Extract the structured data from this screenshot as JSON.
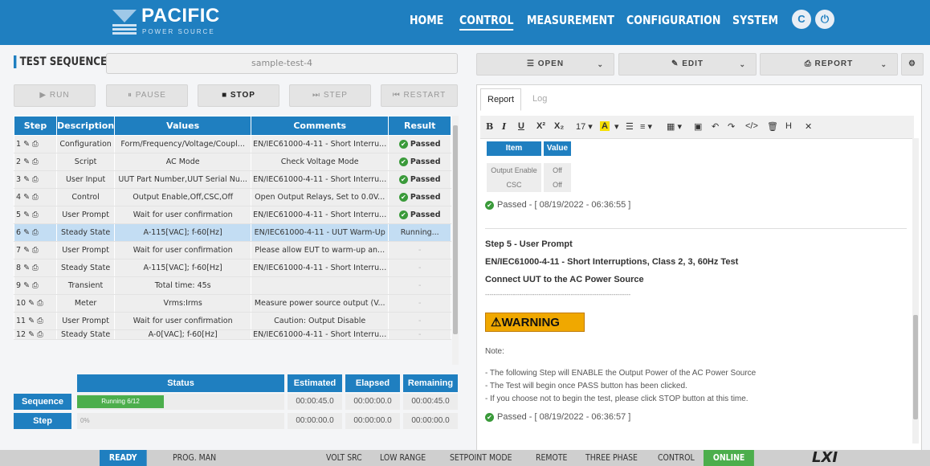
{
  "header": {
    "brand": "PACIFIC",
    "brand_sub": "POWER SOURCE",
    "nav": [
      "HOME",
      "CONTROL",
      "MEASUREMENT",
      "CONFIGURATION",
      "SYSTEM"
    ],
    "active_nav": "CONTROL",
    "icons": [
      "refresh-icon",
      "power-icon"
    ]
  },
  "sequence": {
    "title": "TEST SEQUENCE",
    "name": "sample-test-4"
  },
  "toolbar": {
    "run": "▶ RUN",
    "pause": "⏸ PAUSE",
    "stop": "■ STOP",
    "step": "⏭ STEP",
    "restart": "⏮ RESTART"
  },
  "actions": {
    "open": "☰ OPEN",
    "edit": "✎ EDIT",
    "report": "⎙ REPORT"
  },
  "steps_table": {
    "columns": [
      "Step",
      "Description",
      "Values",
      "Comments",
      "Result"
    ],
    "rows": [
      {
        "step": "1 ✎ ⎙",
        "description": "Configuration",
        "values": "Form/Frequency/Voltage/Coupl...",
        "comments": "EN/IEC61000-4-11 - Short Interru...",
        "result": "Passed"
      },
      {
        "step": "2 ✎ ⎙",
        "description": "Script",
        "values": "AC Mode",
        "comments": "Check Voltage Mode",
        "result": "Passed"
      },
      {
        "step": "3 ✎ ⎙",
        "description": "User Input",
        "values": "UUT Part Number,UUT Serial Nu...",
        "comments": "EN/IEC61000-4-11 - Short Interru...",
        "result": "Passed"
      },
      {
        "step": "4 ✎ ⎙",
        "description": "Control",
        "values": "Output Enable,Off,CSC,Off",
        "comments": "Open Output Relays, Set to 0.0V...",
        "result": "Passed"
      },
      {
        "step": "5 ✎ ⎙",
        "description": "User Prompt",
        "values": "Wait for user confirmation",
        "comments": "EN/IEC61000-4-11 - Short Interru...",
        "result": "Passed"
      },
      {
        "step": "6 ✎ ⎙",
        "description": "Steady State",
        "values": "A-115[VAC]; f-60[Hz]",
        "comments": "EN/IEC61000-4-11 - UUT Warm-Up",
        "result": "Running..."
      },
      {
        "step": "7 ✎ ⎙",
        "description": "User Prompt",
        "values": "Wait for user confirmation",
        "comments": "Please allow EUT to warm-up an...",
        "result": "-"
      },
      {
        "step": "8 ✎ ⎙",
        "description": "Steady State",
        "values": "A-115[VAC]; f-60[Hz]",
        "comments": "EN/IEC61000-4-11 - Short Interru...",
        "result": "-"
      },
      {
        "step": "9 ✎ ⎙",
        "description": "Transient",
        "values": "Total time: 45s",
        "comments": "",
        "result": "-"
      },
      {
        "step": "10 ✎ ⎙",
        "description": "Meter",
        "values": "Vrms:Irms",
        "comments": "Measure power source output (V...",
        "result": "-"
      },
      {
        "step": "11 ✎ ⎙",
        "description": "User Prompt",
        "values": "Wait for user confirmation",
        "comments": "Caution: Output Disable",
        "result": "-"
      },
      {
        "step": "12 ✎ ⎙",
        "description": "Steady State",
        "values": "A-0[VAC]; f-60[Hz]",
        "comments": "EN/IEC61000-4-11 - Short Interru...",
        "result": "-"
      }
    ]
  },
  "status": {
    "headers": [
      "Status",
      "Estimated",
      "Elapsed",
      "Remaining"
    ],
    "sequence_label": "Sequence",
    "step_label": "Step",
    "sequence_progress": "Running 6/12",
    "sequence_progress_fraction": 0.5,
    "step_progress": "0%",
    "sequence_times": [
      "00:00:45.0",
      "00:00:00.0",
      "00:00:45.0"
    ],
    "step_times": [
      "00:00:00.0",
      "00:00:00.0",
      "00:00:00.0"
    ]
  },
  "report": {
    "tabs": [
      "Report",
      "Log"
    ],
    "editor_tools": [
      "B",
      "I",
      "U",
      "X²",
      "X₂",
      "17 ▾",
      "A",
      "▾",
      "☰",
      "≡ ▾",
      "▦ ▾",
      "▣",
      "↶",
      "↷",
      "</>",
      "🗑",
      "H",
      "✕"
    ],
    "mini_table": {
      "headers": [
        "Item",
        "Value"
      ],
      "rows": [
        [
          "Output Enable",
          "Off"
        ],
        [
          "CSC",
          "Off"
        ]
      ]
    },
    "passed_1": "Passed - [ 08/19/2022 - 06:36:55 ]",
    "step5_title": "Step 5 - User Prompt",
    "step5_test": "EN/IEC61000-4-11 - Short Interruptions, Class 2, 3, 60Hz Test",
    "step5_action": "Connect UUT to the AC Power Source",
    "divider": "--------------------------------------------------------------------",
    "warning": "⚠WARNING",
    "note_label": "Note:",
    "notes": [
      "- The following Step will ENABLE the Output Power of the AC Power Source",
      "- The Test will begin once PASS button has been clicked.",
      "- If you choose not to begin the test, please click STOP button at this time."
    ],
    "passed_2": "Passed - [ 08/19/2022 - 06:36:57 ]"
  },
  "statusbar": {
    "items": [
      "READY",
      "PROG. MAN",
      "VOLT SRC",
      "LOW RANGE",
      "SETPOINT MODE",
      "REMOTE",
      "THREE PHASE",
      "CONTROL",
      "ONLINE"
    ],
    "logo": "LXI"
  },
  "colors": {
    "primary": "#1f7fc0",
    "success": "#4cae4c",
    "warning": "#f0a800",
    "highlight_row": "#c3ddf3"
  }
}
